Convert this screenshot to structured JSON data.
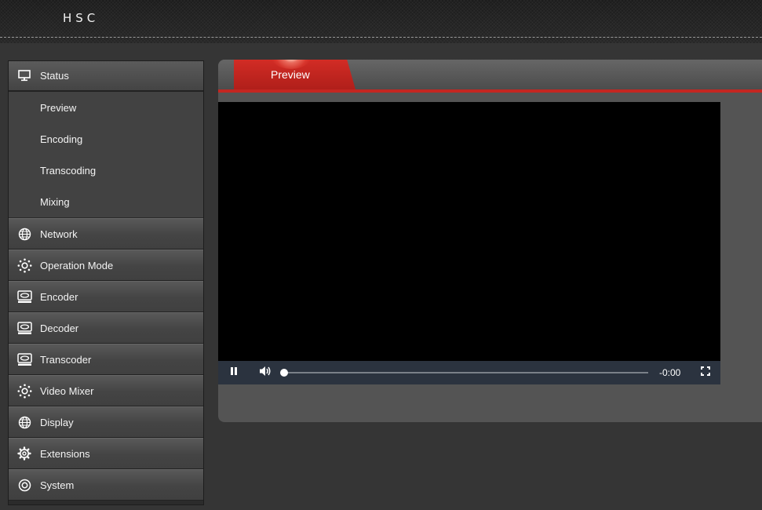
{
  "header": {
    "logo": "HSC"
  },
  "sidebar": {
    "status": {
      "label": "Status",
      "icon": "monitor-icon"
    },
    "status_sub": [
      {
        "label": "Preview"
      },
      {
        "label": "Encoding"
      },
      {
        "label": "Transcoding"
      },
      {
        "label": "Mixing"
      }
    ],
    "items": [
      {
        "label": "Network",
        "icon": "globe-icon"
      },
      {
        "label": "Operation Mode",
        "icon": "sun-gear-icon"
      },
      {
        "label": "Encoder",
        "icon": "disk-drive-icon"
      },
      {
        "label": "Decoder",
        "icon": "disk-drive-icon"
      },
      {
        "label": "Transcoder",
        "icon": "disk-drive-icon"
      },
      {
        "label": "Video Mixer",
        "icon": "sun-gear-icon"
      },
      {
        "label": "Display",
        "icon": "globe-icon"
      },
      {
        "label": "Extensions",
        "icon": "gear-icon"
      },
      {
        "label": "System",
        "icon": "target-icon"
      }
    ]
  },
  "main": {
    "tabs": [
      {
        "label": "Preview",
        "active": true
      }
    ],
    "player": {
      "state": "playing",
      "time_remaining": "-0:00",
      "progress": 0
    }
  },
  "colors": {
    "accent": "#c32621",
    "background": "#353535",
    "panel": "#545454",
    "controls": "#2b333f"
  }
}
